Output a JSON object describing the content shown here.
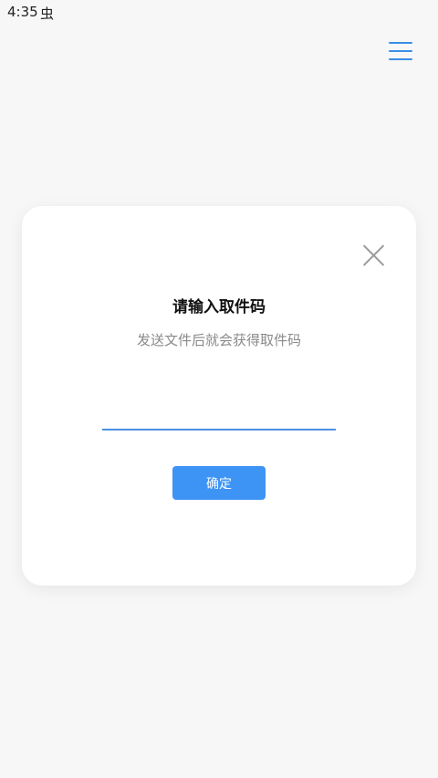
{
  "status_bar": {
    "time": "4:35",
    "notification_icon": "bug-icon",
    "notification_glyph": "虫"
  },
  "header": {
    "menu_icon": "hamburger-menu-icon"
  },
  "dialog": {
    "title": "请输入取件码",
    "subtitle": "发送文件后就会获得取件码",
    "code_input_value": "",
    "confirm_label": "确定",
    "close_icon": "close-icon"
  },
  "colors": {
    "accent": "#3d94f5",
    "input_underline": "#4a90e2",
    "menu_icon": "#3a8ee6",
    "background": "#f7f7f8"
  }
}
